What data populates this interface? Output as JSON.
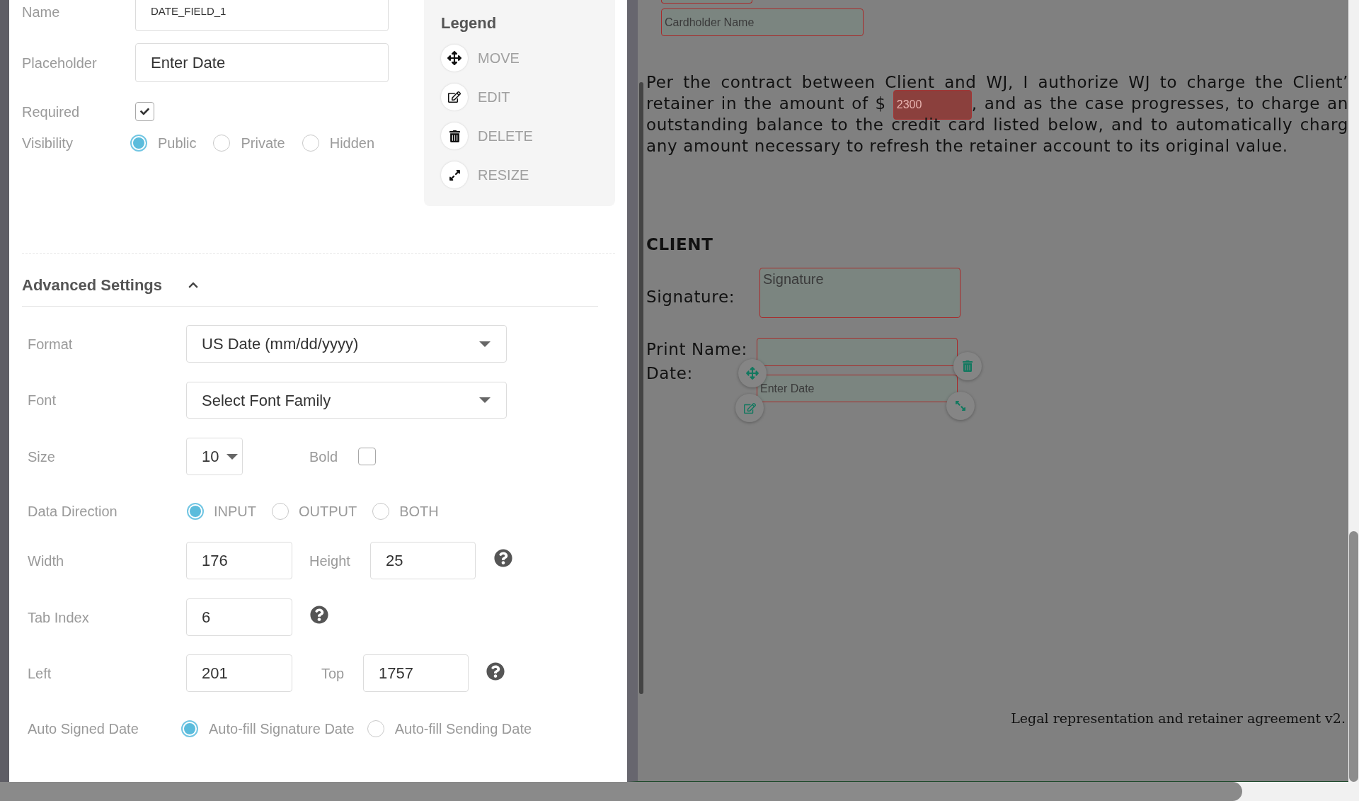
{
  "field_settings": {
    "name": {
      "label": "Name",
      "value": "DATE_FIELD_1"
    },
    "placeholder": {
      "label": "Placeholder",
      "value": "Enter Date"
    },
    "required": {
      "label": "Required",
      "checked": true
    },
    "visibility": {
      "label": "Visibility",
      "options": [
        {
          "label": "Public",
          "selected": true
        },
        {
          "label": "Private",
          "selected": false
        },
        {
          "label": "Hidden",
          "selected": false
        }
      ]
    }
  },
  "legend": {
    "title": "Legend",
    "items": [
      {
        "kind": "move",
        "label": "MOVE"
      },
      {
        "kind": "edit",
        "label": "EDIT"
      },
      {
        "kind": "delete",
        "label": "DELETE"
      },
      {
        "kind": "resize",
        "label": "RESIZE"
      }
    ]
  },
  "advanced_settings": {
    "title": "Advanced Settings",
    "expanded": true,
    "format": {
      "label": "Format",
      "value": "US Date (mm/dd/yyyy)"
    },
    "font": {
      "label": "Font",
      "value": "Select Font Family"
    },
    "size": {
      "label": "Size",
      "value": "10"
    },
    "bold": {
      "label": "Bold",
      "checked": false
    },
    "data_direction": {
      "label": "Data Direction",
      "options": [
        {
          "label": "INPUT",
          "selected": true
        },
        {
          "label": "OUTPUT",
          "selected": false
        },
        {
          "label": "BOTH",
          "selected": false
        }
      ]
    },
    "width": {
      "label": "Width",
      "value": "176"
    },
    "height": {
      "label": "Height",
      "value": "25"
    },
    "tab_index": {
      "label": "Tab Index",
      "value": "6"
    },
    "left": {
      "label": "Left",
      "value": "201"
    },
    "top": {
      "label": "Top",
      "value": "1757"
    },
    "auto_signed_date": {
      "label": "Auto Signed Date",
      "options": [
        {
          "label": "Auto-fill Signature Date",
          "selected": true
        },
        {
          "label": "Auto-fill Sending Date",
          "selected": false
        }
      ]
    }
  },
  "document": {
    "fields": [
      {
        "selected": false
      },
      {
        "placeholder": "Cardholder Name",
        "selected": false
      },
      {
        "placeholder": "Signature",
        "selected": false
      },
      {
        "selected": false
      },
      {
        "placeholder": "Enter Date",
        "selected": true
      }
    ],
    "paragraph": [
      {
        "text": "Per the contract between Client and WJ, I authorize WJ to charge the Client’"
      },
      {
        "text": "retainer in the amount of $",
        "field": {
          "value": "2300",
          "selected": false
        },
        "text_after": ", and as the case progresses, to charge an"
      },
      {
        "text": "outstanding balance to the credit card listed below, and to automatically charg"
      },
      {
        "text": "any amount necessary to refresh the retainer account to its original value."
      }
    ],
    "heading": "CLIENT",
    "labels": [
      "Signature:",
      "Print Name:",
      "Date:"
    ],
    "footer": "Legal representation and retainer agreement v2."
  }
}
